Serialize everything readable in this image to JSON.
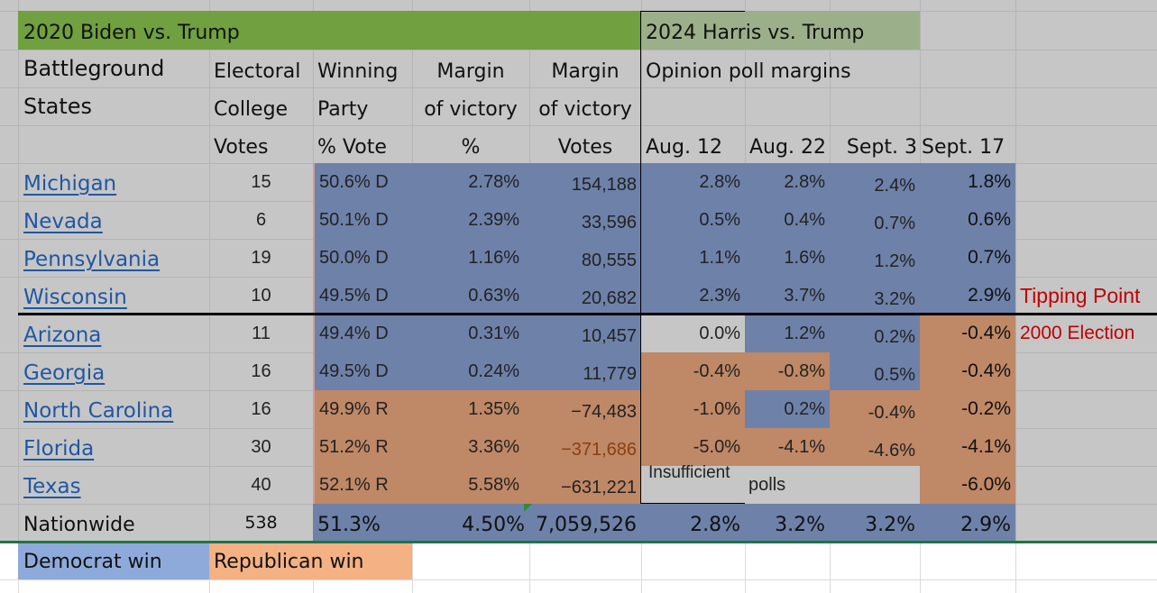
{
  "title_2020": "2020 Biden vs. Trump",
  "title_2024": "2024 Harris vs. Trump",
  "headers": {
    "state": [
      "Battleground",
      "States",
      ""
    ],
    "electoral": [
      "Electoral",
      "College",
      "Votes"
    ],
    "winning": [
      "Winning",
      "Party",
      "% Vote"
    ],
    "margin_pct": [
      "Margin",
      "of victory",
      "%"
    ],
    "margin_votes": [
      "Margin",
      "of victory",
      "Votes"
    ],
    "polls_label": "Opinion poll margins",
    "poll_dates": [
      "Aug. 12",
      "Aug. 22",
      "Sept. 3",
      "Sept. 17"
    ]
  },
  "rows": [
    {
      "state": "Michigan",
      "ev": "15",
      "win": "50.6% D",
      "mpct": "2.78%",
      "mvotes": "154,188",
      "polls": [
        "2.8%",
        "2.8%",
        "2.4%",
        "1.8%"
      ],
      "party": "D",
      "poll_colors": [
        "blue",
        "blue",
        "blue",
        "blue"
      ],
      "note": ""
    },
    {
      "state": "Nevada",
      "ev": "6",
      "win": "50.1% D",
      "mpct": "2.39%",
      "mvotes": "33,596",
      "polls": [
        "0.5%",
        "0.4%",
        "0.7%",
        "0.6%"
      ],
      "party": "D",
      "poll_colors": [
        "blue",
        "blue",
        "blue",
        "blue"
      ],
      "note": ""
    },
    {
      "state": "Pennsylvania",
      "ev": "19",
      "win": "50.0% D",
      "mpct": "1.16%",
      "mvotes": "80,555",
      "polls": [
        "1.1%",
        "1.6%",
        "1.2%",
        "0.7%"
      ],
      "party": "D",
      "poll_colors": [
        "blue",
        "blue",
        "blue",
        "blue"
      ],
      "note": ""
    },
    {
      "state": "Wisconsin",
      "ev": "10",
      "win": "49.5% D",
      "mpct": "0.63%",
      "mvotes": "20,682",
      "polls": [
        "2.3%",
        "3.7%",
        "3.2%",
        "2.9%"
      ],
      "party": "D",
      "poll_colors": [
        "blue",
        "blue",
        "blue",
        "blue"
      ],
      "note": "Tipping Point"
    },
    {
      "state": "Arizona",
      "ev": "11",
      "win": "49.4% D",
      "mpct": "0.31%",
      "mvotes": "10,457",
      "polls": [
        "0.0%",
        "1.2%",
        "0.2%",
        "-0.4%"
      ],
      "party": "D",
      "poll_colors": [
        "gray",
        "blue",
        "blue",
        "orange"
      ],
      "note": "2000 Election"
    },
    {
      "state": "Georgia",
      "ev": "16",
      "win": "49.5% D",
      "mpct": "0.24%",
      "mvotes": "11,779",
      "polls": [
        "-0.4%",
        "-0.8%",
        "0.5%",
        "-0.4%"
      ],
      "party": "D",
      "poll_colors": [
        "orange",
        "orange",
        "blue",
        "orange"
      ],
      "note": ""
    },
    {
      "state": "North Carolina",
      "ev": "16",
      "win": "49.9% R",
      "mpct": "1.35%",
      "mvotes": "−74,483",
      "polls": [
        "-1.0%",
        "0.2%",
        "-0.4%",
        "-0.2%"
      ],
      "party": "R",
      "poll_colors": [
        "orange",
        "blue",
        "orange",
        "orange"
      ],
      "note": ""
    },
    {
      "state": "Florida",
      "ev": "30",
      "win": "51.2% R",
      "mpct": "3.36%",
      "mvotes": "−371,686",
      "polls": [
        "-5.0%",
        "-4.1%",
        "-4.6%",
        "-4.1%"
      ],
      "party": "R",
      "poll_colors": [
        "orange",
        "orange",
        "orange",
        "orange"
      ],
      "note": ""
    },
    {
      "state": "Texas",
      "ev": "40",
      "win": "52.1% R",
      "mpct": "5.58%",
      "mvotes": "−631,221",
      "polls": [
        "Insufficient",
        "polls",
        "",
        "-6.0%"
      ],
      "party": "R",
      "poll_colors": [
        "gray",
        "gray",
        "gray",
        "orange"
      ],
      "note": ""
    }
  ],
  "nationwide": {
    "label": "Nationwide",
    "ev": "538",
    "win": "51.3%",
    "mpct": "4.50%",
    "mvotes": "7,059,526",
    "polls": [
      "2.8%",
      "3.2%",
      "3.2%",
      "2.9%"
    ]
  },
  "legend": {
    "democrat": "Democrat win",
    "republican": "Republican win"
  },
  "colors": {
    "dem": "#6e81a9",
    "rep": "#bf8866",
    "header2020": "#70a040",
    "header2024": "#9bb08a",
    "legend_dem": "#8eaadb",
    "legend_rep": "#f4b183",
    "note": "#c00000"
  }
}
